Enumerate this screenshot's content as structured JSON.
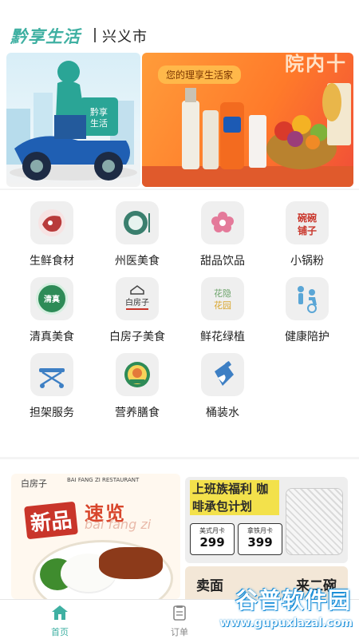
{
  "header": {
    "brand": "黔享生活",
    "city": "兴义市"
  },
  "banners": {
    "left": {
      "brand_tag": "黔享生活",
      "small_text": "黔享生活"
    },
    "right": {
      "tag": "您的理享生活家",
      "headline": "院内十"
    }
  },
  "categories": [
    {
      "label": "生鲜食材",
      "icon": "fresh-food-icon",
      "color": "#b83b3b"
    },
    {
      "label": "州医美食",
      "icon": "hospital-food-icon",
      "color": "#3a7f6e"
    },
    {
      "label": "甜品饮品",
      "icon": "dessert-drink-icon",
      "color": "#e47a9a"
    },
    {
      "label": "小锅粉",
      "icon": "noodle-icon",
      "color": "#c9352a",
      "logo_text": "碗碗铺子"
    },
    {
      "label": "清真美食",
      "icon": "halal-food-icon",
      "color": "#2e8b57",
      "logo_text": "清真"
    },
    {
      "label": "白房子美食",
      "icon": "bai-fang-zi-icon",
      "color": "#444444",
      "logo_text": "白房子"
    },
    {
      "label": "鲜花绿植",
      "icon": "flower-plant-icon",
      "color": "#6ca36a",
      "logo_text": "花隐花园"
    },
    {
      "label": "健康陪护",
      "icon": "healthcare-icon",
      "color": "#5aa6d6"
    },
    {
      "label": "担架服务",
      "icon": "stretcher-icon",
      "color": "#3d7fc4"
    },
    {
      "label": "营养膳食",
      "icon": "nutrition-meal-icon",
      "color": "#d9a52b"
    },
    {
      "label": "桶装水",
      "icon": "bottled-water-icon",
      "color": "#3d7fc4"
    }
  ],
  "promos": {
    "baifangzi": {
      "logo": "白房子",
      "logo_en": "BAI FANG ZI RESTAURANT",
      "tag": "新品",
      "title": "速览",
      "subtitle": "bai fang zi"
    },
    "coffee": {
      "title": "上班族福利 咖啡承包计划",
      "card_a_name": "美式月卡",
      "card_a_price": "299",
      "card_b_name": "拿铁月卡",
      "card_b_price": "399"
    },
    "bottom": {
      "left": "卖面",
      "right": "来二碗"
    }
  },
  "watermark": {
    "cn": "谷普软件园",
    "url": "www.gupuxlazal.com"
  },
  "tabbar": {
    "home": "首页",
    "order": "订单",
    "active_color": "#3fb0a2"
  }
}
